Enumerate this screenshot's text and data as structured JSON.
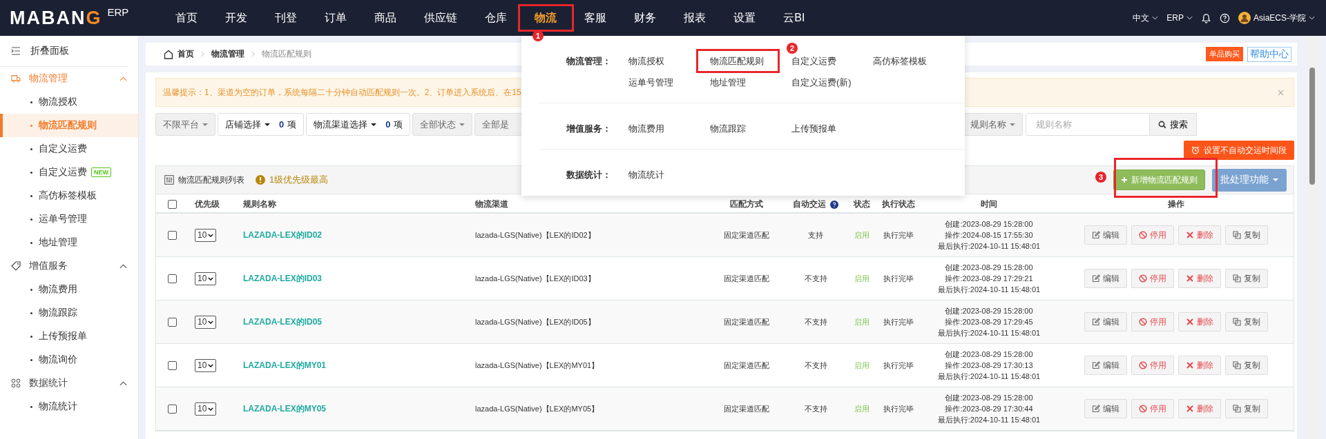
{
  "top_nav": {
    "logo": "MABANG",
    "logo_suffix": "ERP",
    "items": [
      {
        "label": "首页",
        "selected": false
      },
      {
        "label": "开发",
        "selected": false
      },
      {
        "label": "刊登",
        "selected": false
      },
      {
        "label": "订单",
        "selected": false
      },
      {
        "label": "商品",
        "selected": false
      },
      {
        "label": "供应链",
        "selected": false
      },
      {
        "label": "仓库",
        "selected": false
      },
      {
        "label": "物流",
        "selected": true
      },
      {
        "label": "客服",
        "selected": false
      },
      {
        "label": "财务",
        "selected": false
      },
      {
        "label": "报表",
        "selected": false
      },
      {
        "label": "设置",
        "selected": false
      },
      {
        "label": "云BI",
        "selected": false
      }
    ],
    "language": "中文",
    "system": "ERP",
    "user": "AsiaECS-学院"
  },
  "sidebar": {
    "collapse_label": "折叠面板",
    "sections": [
      {
        "title": "物流管理",
        "active": true,
        "expanded": true,
        "children": [
          {
            "label": "物流授权",
            "selected": false
          },
          {
            "label": "物流匹配规则",
            "selected": true
          },
          {
            "label": "自定义运费",
            "selected": false
          },
          {
            "label": "自定义运费",
            "selected": false,
            "badge": "NEW"
          },
          {
            "label": "高仿标签模板",
            "selected": false
          },
          {
            "label": "运单号管理",
            "selected": false
          },
          {
            "label": "地址管理",
            "selected": false
          }
        ]
      },
      {
        "title": "增值服务",
        "active": false,
        "expanded": true,
        "children": [
          {
            "label": "物流费用",
            "selected": false
          },
          {
            "label": "物流跟踪",
            "selected": false
          },
          {
            "label": "上传预报单",
            "selected": false
          },
          {
            "label": "物流询价",
            "selected": false
          }
        ]
      },
      {
        "title": "数据统计",
        "active": false,
        "expanded": true,
        "children": [
          {
            "label": "物流统计",
            "selected": false
          }
        ]
      }
    ]
  },
  "breadcrumb": [
    "首页",
    "物流管理",
    "物流匹配规则"
  ],
  "header_buttons": {
    "buy": "单品购买",
    "help": "帮助中心"
  },
  "notice": "温馨提示：1、渠道为空的订单，系统每隔二十分钟自动匹配规则一次。2、订单进入系统后、在15",
  "filters": [
    {
      "kind": "dropdown",
      "label": "不限平台"
    },
    {
      "kind": "count",
      "label": "店铺选择",
      "count": "0",
      "unit": "项"
    },
    {
      "kind": "count",
      "label": "物流渠道选择",
      "count": "0",
      "unit": "项"
    },
    {
      "kind": "dropdown",
      "label": "全部状态"
    },
    {
      "kind": "plain",
      "label": "全部是"
    }
  ],
  "search": {
    "field_label": "规则名称",
    "placeholder": "规则名称",
    "button": "搜索"
  },
  "schedule_button": "设置不自动交运时间段",
  "table": {
    "title": "物流匹配规则列表",
    "hint": "1级优先级最高",
    "add_button": "新增物流匹配规则",
    "batch_button": "批处理功能",
    "select_all_checked": false,
    "columns": [
      "优先级",
      "规则名称",
      "物流渠道",
      "匹配方式",
      "自动交运",
      "状态",
      "执行状态",
      "时间",
      "操作"
    ],
    "rows": [
      {
        "checked": false,
        "priority": "10",
        "name": "LAZADA-LEX的ID02",
        "channel": "lazada-LGS(Native)【LEX的ID02】",
        "match": "固定渠道匹配",
        "auto_ship": "支持",
        "status": "启用",
        "exec_status": "执行完毕",
        "times": [
          "创建:2023-08-29 15:28:00",
          "操作:2024-08-15 17:55:30",
          "最后执行:2024-10-11 15:48:01"
        ],
        "actions": [
          {
            "kind": "edit",
            "label": "编辑"
          },
          {
            "kind": "disable",
            "label": "停用"
          },
          {
            "kind": "delete",
            "label": "删除"
          },
          {
            "kind": "copy",
            "label": "复制"
          }
        ]
      },
      {
        "checked": false,
        "priority": "10",
        "name": "LAZADA-LEX的ID03",
        "channel": "lazada-LGS(Native)【LEX的ID03】",
        "match": "固定渠道匹配",
        "auto_ship": "不支持",
        "status": "启用",
        "exec_status": "执行完毕",
        "times": [
          "创建:2023-08-29 15:28:00",
          "操作:2023-08-29 17:29:21",
          "最后执行:2024-10-11 15:48:01"
        ],
        "actions": [
          {
            "kind": "edit",
            "label": "编辑"
          },
          {
            "kind": "disable",
            "label": "停用"
          },
          {
            "kind": "delete",
            "label": "删除"
          },
          {
            "kind": "copy",
            "label": "复制"
          }
        ]
      },
      {
        "checked": false,
        "priority": "10",
        "name": "LAZADA-LEX的ID05",
        "channel": "lazada-LGS(Native)【LEX的ID05】",
        "match": "固定渠道匹配",
        "auto_ship": "不支持",
        "status": "启用",
        "exec_status": "执行完毕",
        "times": [
          "创建:2023-08-29 15:28:00",
          "操作:2023-08-29 17:29:45",
          "最后执行:2024-10-11 15:48:01"
        ],
        "actions": [
          {
            "kind": "edit",
            "label": "编辑"
          },
          {
            "kind": "disable",
            "label": "停用"
          },
          {
            "kind": "delete",
            "label": "删除"
          },
          {
            "kind": "copy",
            "label": "复制"
          }
        ]
      },
      {
        "checked": false,
        "priority": "10",
        "name": "LAZADA-LEX的MY01",
        "channel": "lazada-LGS(Native)【LEX的MY01】",
        "match": "固定渠道匹配",
        "auto_ship": "不支持",
        "status": "启用",
        "exec_status": "执行完毕",
        "times": [
          "创建:2023-08-29 15:28:00",
          "操作:2023-08-29 17:30:13",
          "最后执行:2024-10-11 15:48:01"
        ],
        "actions": [
          {
            "kind": "edit",
            "label": "编辑"
          },
          {
            "kind": "disable",
            "label": "停用"
          },
          {
            "kind": "delete",
            "label": "删除"
          },
          {
            "kind": "copy",
            "label": "复制"
          }
        ]
      },
      {
        "checked": false,
        "priority": "10",
        "name": "LAZADA-LEX的MY05",
        "channel": "lazada-LGS(Native)【LEX的MY05】",
        "match": "固定渠道匹配",
        "auto_ship": "不支持",
        "status": "启用",
        "exec_status": "执行完毕",
        "times": [
          "创建:2023-08-29 15:28:00",
          "操作:2023-08-29 17:30:44",
          "最后执行:2024-10-11 15:48:01"
        ],
        "actions": [
          {
            "kind": "edit",
            "label": "编辑"
          },
          {
            "kind": "disable",
            "label": "停用"
          },
          {
            "kind": "delete",
            "label": "删除"
          },
          {
            "kind": "copy",
            "label": "复制"
          }
        ]
      }
    ]
  },
  "dropdown_menu": {
    "groups": [
      {
        "label": "物流管理：",
        "items": [
          "物流授权",
          "物流匹配规则",
          "自定义运费",
          "高仿标签模板",
          "运单号管理",
          "地址管理",
          "自定义运费(新)"
        ]
      },
      {
        "label": "增值服务：",
        "items": [
          "物流费用",
          "物流跟踪",
          "上传预报单"
        ]
      },
      {
        "label": "数据统计：",
        "items": [
          "物流统计"
        ]
      }
    ]
  },
  "annotations": [
    "1",
    "2",
    "3"
  ]
}
